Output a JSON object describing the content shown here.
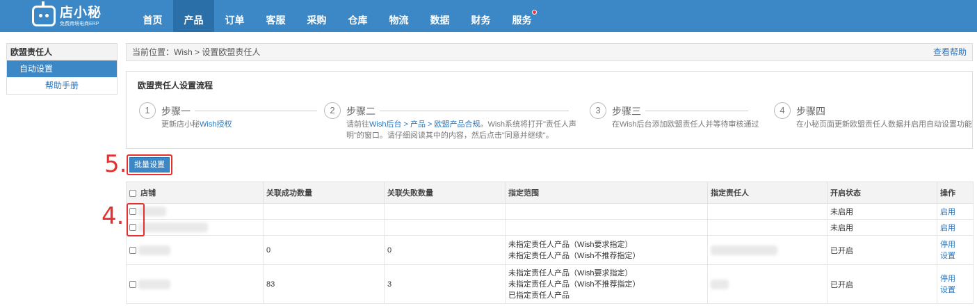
{
  "brand": {
    "title": "店小秘",
    "subtitle": "免费跨境电商ERP"
  },
  "nav": {
    "items": [
      {
        "label": "首页",
        "active": false
      },
      {
        "label": "产品",
        "active": true
      },
      {
        "label": "订单",
        "active": false
      },
      {
        "label": "客服",
        "active": false
      },
      {
        "label": "采购",
        "active": false
      },
      {
        "label": "仓库",
        "active": false
      },
      {
        "label": "物流",
        "active": false
      },
      {
        "label": "数据",
        "active": false
      },
      {
        "label": "财务",
        "active": false
      },
      {
        "label": "服务",
        "active": false,
        "badge": true
      }
    ]
  },
  "sidebar": {
    "heading": "欧盟责任人",
    "active_item": "自动设置",
    "help": "帮助手册"
  },
  "breadcrumb": {
    "text": "当前位置：Wish > 设置欧盟责任人",
    "help": "查看帮助"
  },
  "flow": {
    "title": "欧盟责任人设置流程",
    "steps": [
      {
        "num": "1",
        "name": "步骤一",
        "desc1_pre": "更新店小秘",
        "desc1_link": "Wish授权",
        "desc1_post": "",
        "desc2": ""
      },
      {
        "num": "2",
        "name": "步骤二",
        "desc1_pre": "请前往",
        "desc1_link": "Wish后台 > 产品 > 欧盟产品合规",
        "desc1_post": "。Wish系统将打开\"责任人声",
        "desc2": "明\"的窗口。请仔细阅读其中的内容，然后点击\"同意并继续\"。"
      },
      {
        "num": "3",
        "name": "步骤三",
        "desc1_pre": "在Wish后台添加欧盟责任人并等待审核通过",
        "desc1_link": "",
        "desc1_post": "",
        "desc2": ""
      },
      {
        "num": "4",
        "name": "步骤四",
        "desc1_pre": "在小秘页面更新欧盟责任人数据并启用自动设置功能",
        "desc1_link": "",
        "desc1_post": "",
        "desc2": ""
      }
    ]
  },
  "annotations": {
    "five": "5.",
    "four": "4."
  },
  "batch_button": "批量设置",
  "table": {
    "headers": [
      "店铺",
      "关联成功数量",
      "关联失败数量",
      "指定范围",
      "指定责任人",
      "开启状态",
      "操作"
    ],
    "rows": [
      {
        "success": "",
        "fail": "",
        "scope": [],
        "status": "未启用",
        "status_on": false,
        "actions": [
          "启用"
        ]
      },
      {
        "success": "",
        "fail": "",
        "scope": [],
        "status": "未启用",
        "status_on": false,
        "actions": [
          "启用"
        ]
      },
      {
        "success": "0",
        "fail": "0",
        "scope": [
          "未指定责任人产品（Wish要求指定）",
          "未指定责任人产品（Wish不推荐指定）"
        ],
        "status": "已开启",
        "status_on": true,
        "actions": [
          "停用",
          "设置"
        ]
      },
      {
        "success": "83",
        "fail": "3",
        "scope": [
          "未指定责任人产品（Wish要求指定）",
          "未指定责任人产品（Wish不推荐指定）",
          "已指定责任人产品"
        ],
        "status": "已开启",
        "status_on": true,
        "actions": [
          "停用",
          "设置"
        ]
      }
    ]
  }
}
